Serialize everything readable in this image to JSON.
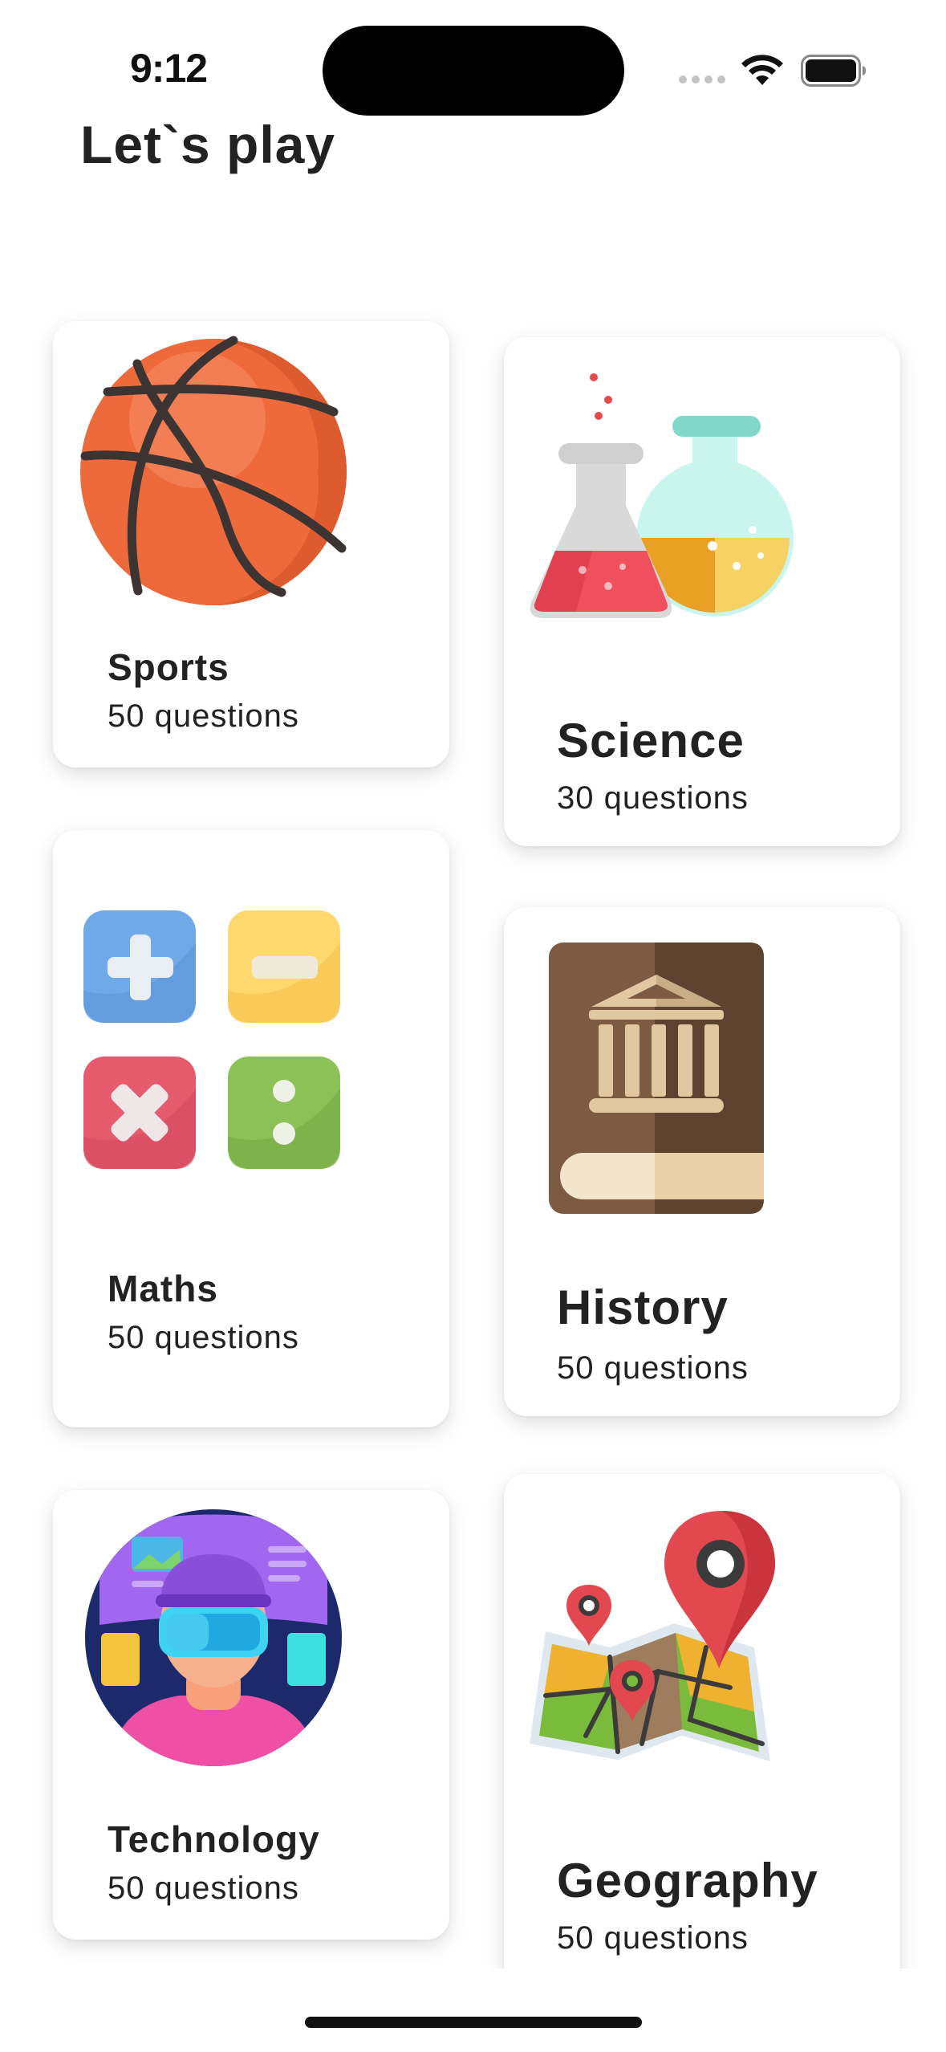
{
  "status_bar": {
    "time": "9:12"
  },
  "header": {
    "title": "Let`s play"
  },
  "categories": [
    {
      "name": "Sports",
      "questions": "50 questions",
      "icon": "basketball-icon"
    },
    {
      "name": "Science",
      "questions": "30 questions",
      "icon": "lab-flasks-icon"
    },
    {
      "name": "Maths",
      "questions": "50 questions",
      "icon": "math-operators-icon"
    },
    {
      "name": "History",
      "questions": "50 questions",
      "icon": "history-book-icon"
    },
    {
      "name": "Technology",
      "questions": "50 questions",
      "icon": "vr-headset-person-icon"
    },
    {
      "name": "Geography",
      "questions": "50 questions",
      "icon": "map-pins-icon"
    }
  ]
}
